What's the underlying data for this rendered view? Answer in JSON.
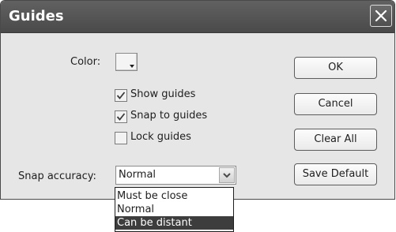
{
  "dialog": {
    "title": "Guides",
    "close_icon": "close-icon"
  },
  "color": {
    "label": "Color:",
    "swatch_color": "#f4f4f4"
  },
  "checkboxes": [
    {
      "label": "Show guides",
      "checked": true
    },
    {
      "label": "Snap to guides",
      "checked": true
    },
    {
      "label": "Lock guides",
      "checked": false
    }
  ],
  "snap_accuracy": {
    "label": "Snap accuracy:",
    "value": "Normal",
    "options": [
      "Must be close",
      "Normal",
      "Can be distant"
    ],
    "highlighted_option": "Can be distant"
  },
  "buttons": {
    "ok": "OK",
    "cancel": "Cancel",
    "clear_all": "Clear All",
    "save_default": "Save Default"
  }
}
